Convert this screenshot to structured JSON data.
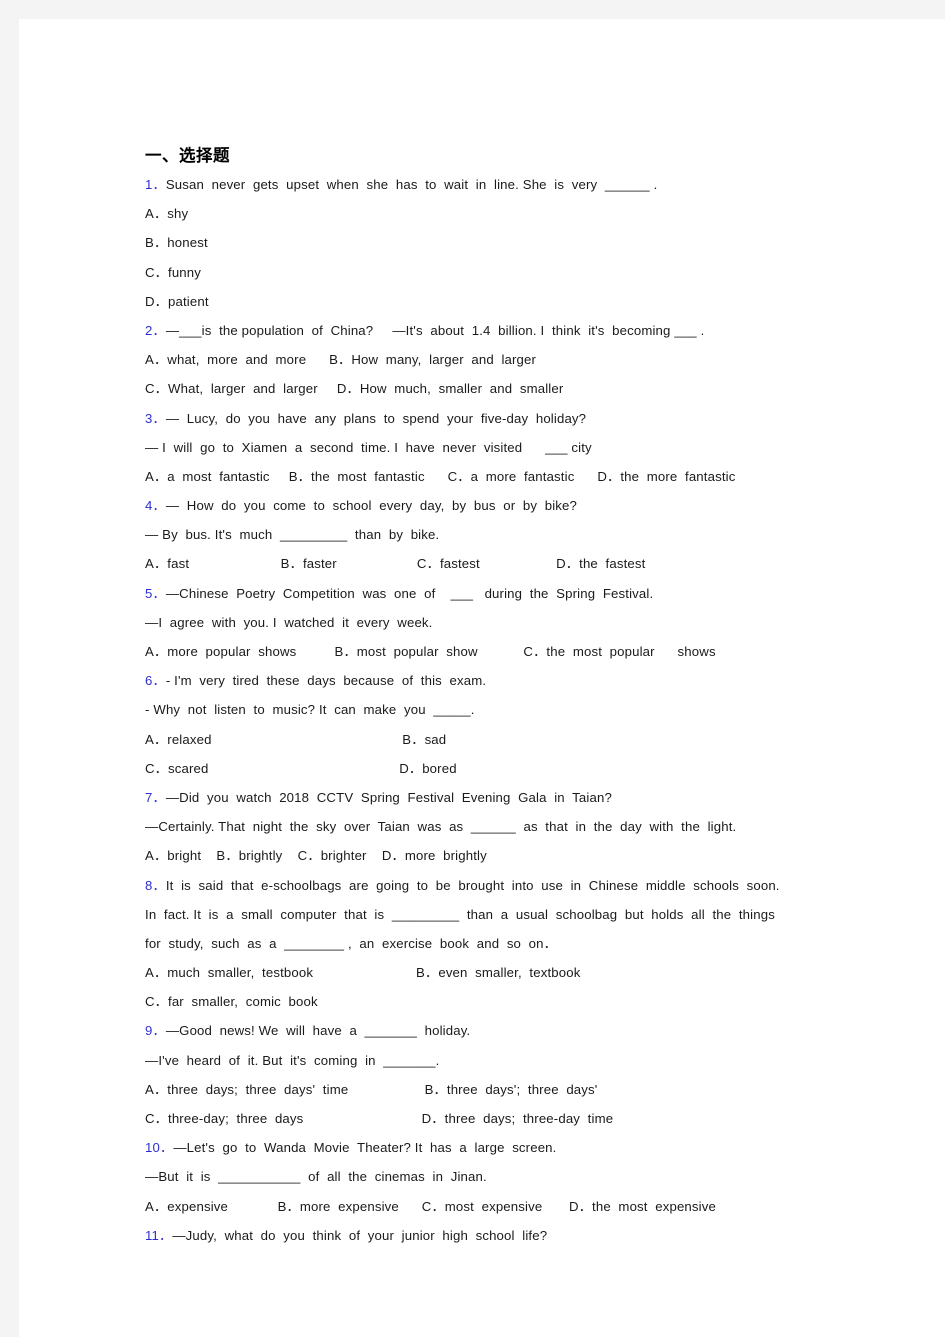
{
  "document": {
    "section_heading": "一、选择题",
    "accent_number_color": "#2f2fd0",
    "text_color": "#1a1a1a",
    "page_background": "#ffffff",
    "frame_color": "#f4f4f4"
  },
  "lines": {
    "q1_stem_num": "1．",
    "q1_stem_text": "Susan  never  gets  upset  when  she  has  to  wait  in  line. She  is  very  ______ .",
    "q1_a": "A．shy",
    "q1_b": "B．honest",
    "q1_c": "C．funny",
    "q1_d": "D．patient",
    "q2_stem_num": "2．",
    "q2_stem_text": "—___is  the population  of  China?     —It's  about  1.4  billion. I  think  it's  becoming ___ .",
    "q2_ab": "A．what,  more  and  more      B．How  many,  larger  and  larger",
    "q2_cd": "C．What,  larger  and  larger     D．How  much,  smaller  and  smaller",
    "q3_stem_num": "3．",
    "q3_stem_text": "—  Lucy,  do  you  have  any  plans  to  spend  your  five-day  holiday?",
    "q3_line2": "— I  will  go  to  Xiamen  a  second  time. I  have  never  visited      ___ city",
    "q3_opts": "A．a  most  fantastic     B．the  most  fantastic      C．a  more  fantastic      D．the  more  fantastic",
    "q4_stem_num": "4．",
    "q4_stem_text": "—  How  do  you  come  to  school  every  day,  by  bus  or  by  bike?",
    "q4_line2": "— By  bus. It's  much  _________  than  by  bike.",
    "q4_opts": "A．fast                        B．faster                     C．fastest                    D．the  fastest",
    "q5_stem_num": "5．",
    "q5_stem_text": "—Chinese  Poetry  Competition  was  one  of    ___   during  the  Spring  Festival.",
    "q5_line2": "—I  agree  with  you. I  watched  it  every  week.",
    "q5_opts": "A．more  popular  shows          B．most  popular  show            C．the  most  popular      shows",
    "q6_stem_num": "6．",
    "q6_stem_text": "- I'm  very  tired  these  days  because  of  this  exam.",
    "q6_line2": "- Why  not  listen  to  music? It  can  make  you  _____.",
    "q6_ab": "A．relaxed                                                  B．sad",
    "q6_cd": "C．scared                                                  D．bored",
    "q7_stem_num": "7．",
    "q7_stem_text": "—Did  you  watch  2018  CCTV  Spring  Festival  Evening  Gala  in  Taian?",
    "q7_line2": "—Certainly. That  night  the  sky  over  Taian  was  as  ______  as  that  in  the  day  with  the  light.",
    "q7_opts": "A．bright    B．brightly    C．brighter    D．more  brightly",
    "q8_stem_num": "8．",
    "q8_stem_text": "It  is  said  that  e-schoolbags  are  going  to  be  brought  into  use  in  Chinese  middle  schools  soon.",
    "q8_line2": "In  fact. It  is  a  small  computer  that  is  _________  than  a  usual  schoolbag  but  holds  all  the  things",
    "q8_line3": "for  study,  such  as  a  ________ ,  an  exercise  book  and  so  on．",
    "q8_ab": "A．much  smaller,  testbook                           B．even  smaller,  textbook",
    "q8_c": "C．far  smaller,  comic  book",
    "q9_stem_num": "9．",
    "q9_stem_text": "—Good  news! We  will  have  a  _______  holiday.",
    "q9_line2": "—I've  heard  of  it. But  it's  coming  in  _______.",
    "q9_ab": "A．three  days;  three  days'  time                    B．three  days';  three  days'",
    "q9_cd": "C．three-day;  three  days                               D．three  days;  three-day  time",
    "q10_stem_num": "10．",
    "q10_stem_text": "—Let's  go  to  Wanda  Movie  Theater? It  has  a  large  screen.",
    "q10_line2": "—But  it  is  ___________  of  all  the  cinemas  in  Jinan.",
    "q10_opts": "A．expensive             B．more  expensive      C．most  expensive       D．the  most  expensive",
    "q11_stem_num": "11．",
    "q11_stem_text": "—Judy,  what  do  you  think  of  your  junior  high  school  life?"
  }
}
